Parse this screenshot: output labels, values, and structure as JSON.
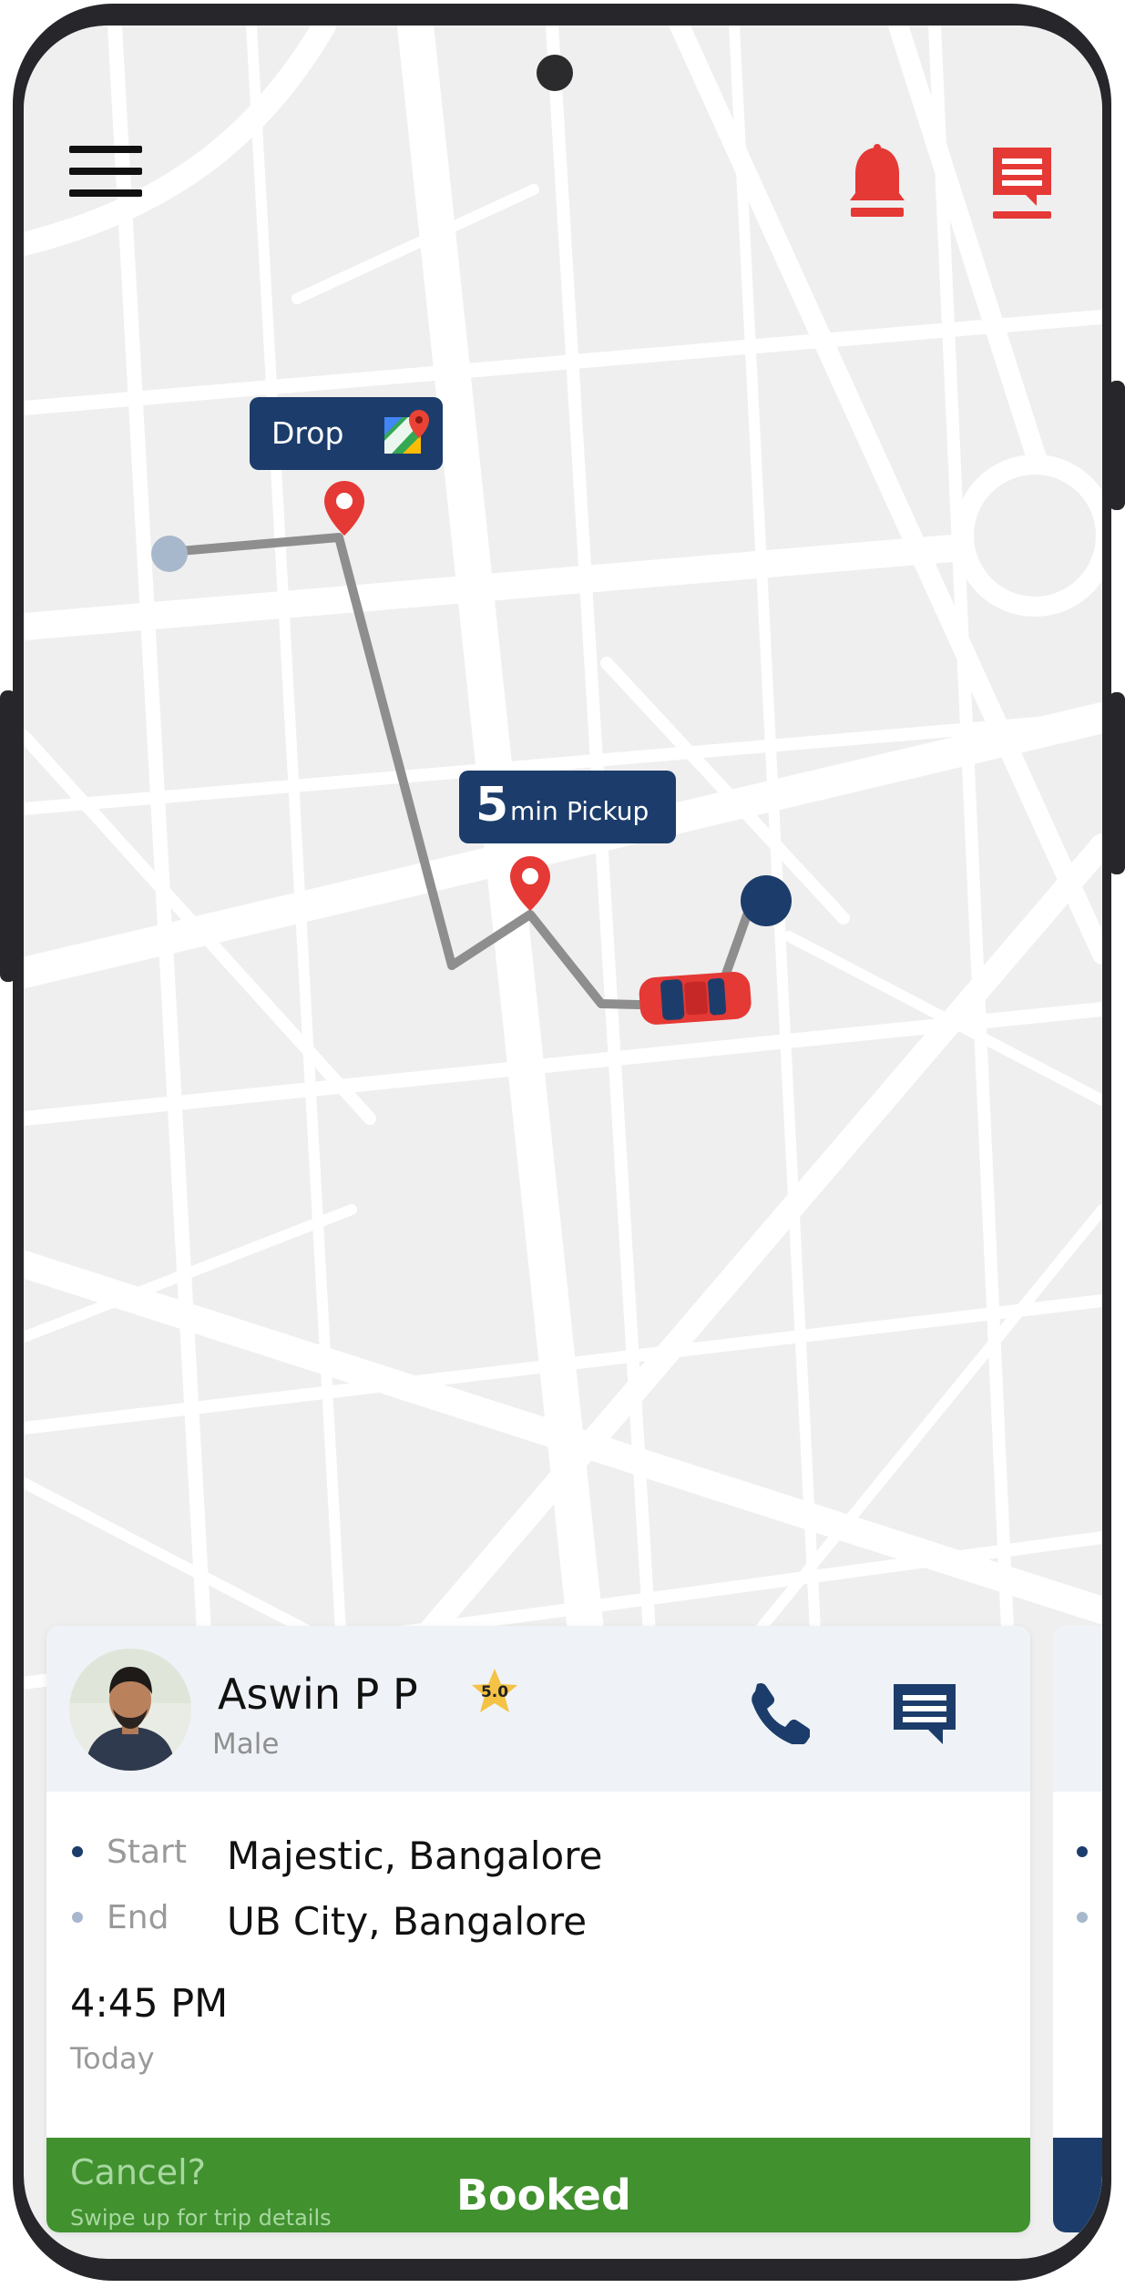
{
  "top_bar": {
    "menu_icon": "hamburger-menu-icon",
    "notification_icon": "bell-icon",
    "messages_icon": "chat-message-icon"
  },
  "map": {
    "drop_tag": {
      "label": "Drop",
      "icon": "google-maps-icon"
    },
    "pickup_tag": {
      "eta_number": "5",
      "eta_unit": "min",
      "label": "Pickup"
    },
    "route_color": "#8e8e8e",
    "pin_color": "#e53935",
    "car_color": "#e53935"
  },
  "trip_card": {
    "driver": {
      "name": "Aswin P P",
      "gender": "Male",
      "rating": "5.0"
    },
    "route": {
      "start_label": "Start",
      "start_value": "Majestic, Bangalore",
      "end_label": "End",
      "end_value": "UB City, Bangalore"
    },
    "time": "4:45 PM",
    "day": "Today",
    "actions": {
      "cancel": "Cancel?",
      "swipe_hint": "Swipe up for trip details",
      "status": "Booked"
    },
    "colors": {
      "accent_navy": "#1c3d6b",
      "booked_green": "#41912f",
      "alert_red": "#e53935"
    }
  }
}
